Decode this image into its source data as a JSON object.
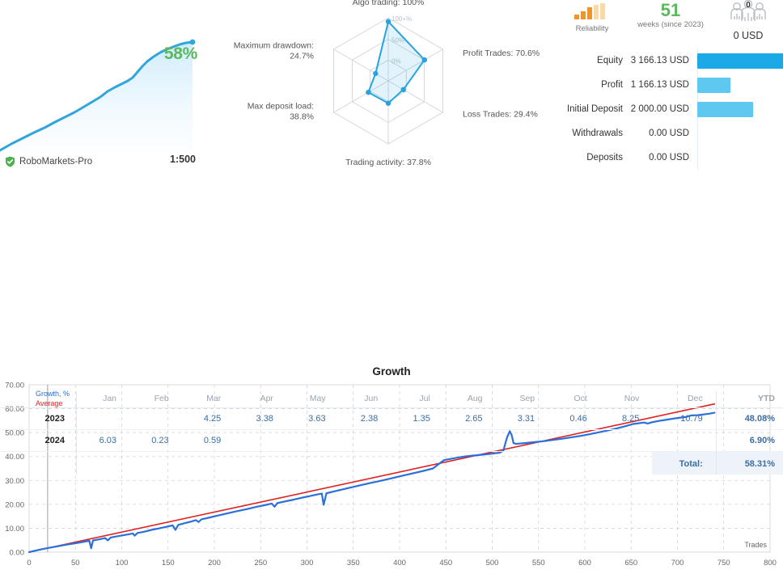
{
  "sparkline": {
    "percent_label": "58%",
    "percent_color": "#5cb85c",
    "broker": "RoboMarkets-Pro",
    "leverage": "1:500",
    "verified_icon": "shield-check-icon",
    "line_color": "#32a5dc",
    "points": [
      [
        0,
        178
      ],
      [
        14,
        170
      ],
      [
        28,
        163
      ],
      [
        42,
        156
      ],
      [
        55,
        150
      ],
      [
        68,
        143
      ],
      [
        80,
        137
      ],
      [
        92,
        131
      ],
      [
        104,
        124
      ],
      [
        114,
        118
      ],
      [
        124,
        112
      ],
      [
        133,
        105
      ],
      [
        142,
        100
      ],
      [
        150,
        96
      ],
      [
        158,
        92
      ],
      [
        164,
        88
      ],
      [
        170,
        81
      ],
      [
        176,
        74
      ],
      [
        182,
        68
      ],
      [
        190,
        62
      ],
      [
        198,
        57
      ],
      [
        206,
        53
      ],
      [
        214,
        50
      ],
      [
        222,
        47
      ],
      [
        230,
        45
      ],
      [
        238,
        44
      ]
    ]
  },
  "radar": {
    "center": [
      218,
      100
    ],
    "max_radius": 78,
    "rings": [
      "100+%",
      "50%",
      "0%"
    ],
    "axes": [
      {
        "name": "Algo trading",
        "label": "Algo trading: 100%",
        "value": 100
      },
      {
        "name": "Profit Trades",
        "label": "Profit Trades: 70.6%",
        "value": 70.6
      },
      {
        "name": "Loss Trades",
        "label": "Loss Trades: 29.4%",
        "value": 29.4
      },
      {
        "name": "Trading activity",
        "label": "Trading activity: 37.8%",
        "value": 37.8
      },
      {
        "name": "Max deposit load",
        "label": "Max deposit load:",
        "label2": "38.8%",
        "value": 38.8
      },
      {
        "name": "Maximum drawdown",
        "label": "Maximum drawdown:",
        "label2": "24.7%",
        "value": 24.7
      }
    ],
    "fill_color": "#2aa3dd",
    "grid_color": "#cfd6dc"
  },
  "stats": {
    "reliability_caption": "Reliability",
    "reliability_icon": "signal-bars-icon",
    "reliability_level": 3,
    "weeks_value": "51",
    "weeks_caption": "weeks (since 2023)",
    "subscribers_icon": "people-icon",
    "subscribers_count": "0",
    "subscribers_amount": "0 USD",
    "rows": [
      {
        "label": "Equity",
        "value": "3 166.13 USD",
        "bar_pct": 100,
        "color": "#1ca9e8"
      },
      {
        "label": "Profit",
        "value": "1 166.13 USD",
        "bar_pct": 37,
        "color": "#5fc8f0"
      },
      {
        "label": "Initial Deposit",
        "value": "2 000.00 USD",
        "bar_pct": 63,
        "color": "#5fc8f0"
      },
      {
        "label": "Withdrawals",
        "value": "0.00 USD",
        "bar_pct": 0,
        "color": "#5fc8f0"
      },
      {
        "label": "Deposits",
        "value": "0.00 USD",
        "bar_pct": 0,
        "color": "#5fc8f0"
      }
    ]
  },
  "chart_data": {
    "type": "line",
    "title": "Growth",
    "xlabel": "Trades",
    "ylabel": "",
    "xlim": [
      0,
      800
    ],
    "ylim": [
      0,
      70
    ],
    "xticks": [
      0,
      50,
      100,
      150,
      200,
      250,
      300,
      350,
      400,
      450,
      500,
      550,
      600,
      650,
      700,
      750,
      800
    ],
    "yticks": [
      "0.00",
      "10.00",
      "20.00",
      "30.00",
      "40.00",
      "50.00",
      "60.00",
      "70.00"
    ],
    "grid": true,
    "legend": [
      {
        "name": "Growth, %",
        "color": "#2a6fdb"
      },
      {
        "name": "Average",
        "color": "#e02020"
      }
    ],
    "series": [
      {
        "name": "Growth, %",
        "color": "#2a6fdb",
        "points": [
          [
            0,
            0.0
          ],
          [
            10,
            0.9
          ],
          [
            20,
            1.7
          ],
          [
            30,
            2.4
          ],
          [
            40,
            3.1
          ],
          [
            50,
            3.7
          ],
          [
            60,
            4.4
          ],
          [
            65,
            4.8
          ],
          [
            67,
            1.6
          ],
          [
            69,
            4.9
          ],
          [
            75,
            5.3
          ],
          [
            82,
            5.9
          ],
          [
            85,
            4.9
          ],
          [
            88,
            6.1
          ],
          [
            95,
            6.6
          ],
          [
            105,
            7.3
          ],
          [
            112,
            7.8
          ],
          [
            114,
            6.9
          ],
          [
            117,
            8.0
          ],
          [
            125,
            8.6
          ],
          [
            132,
            9.3
          ],
          [
            140,
            9.9
          ],
          [
            148,
            10.6
          ],
          [
            155,
            11.2
          ],
          [
            158,
            9.3
          ],
          [
            161,
            11.4
          ],
          [
            168,
            12.1
          ],
          [
            175,
            12.8
          ],
          [
            180,
            13.4
          ],
          [
            183,
            12.6
          ],
          [
            186,
            13.7
          ],
          [
            195,
            14.5
          ],
          [
            205,
            15.4
          ],
          [
            215,
            16.3
          ],
          [
            225,
            17.2
          ],
          [
            235,
            18.0
          ],
          [
            245,
            18.9
          ],
          [
            255,
            19.7
          ],
          [
            262,
            20.3
          ],
          [
            265,
            19.0
          ],
          [
            268,
            20.5
          ],
          [
            275,
            21.1
          ],
          [
            285,
            21.9
          ],
          [
            295,
            22.8
          ],
          [
            305,
            23.6
          ],
          [
            312,
            24.2
          ],
          [
            316,
            24.5
          ],
          [
            318,
            19.8
          ],
          [
            321,
            24.6
          ],
          [
            328,
            25.3
          ],
          [
            338,
            26.2
          ],
          [
            348,
            27.1
          ],
          [
            358,
            28.0
          ],
          [
            368,
            28.9
          ],
          [
            378,
            29.7
          ],
          [
            388,
            30.6
          ],
          [
            398,
            31.5
          ],
          [
            408,
            32.4
          ],
          [
            418,
            33.3
          ],
          [
            428,
            34.2
          ],
          [
            436,
            35.0
          ],
          [
            440,
            36.2
          ],
          [
            448,
            38.5
          ],
          [
            455,
            39.0
          ],
          [
            462,
            39.5
          ],
          [
            470,
            40.0
          ],
          [
            480,
            40.4
          ],
          [
            490,
            40.8
          ],
          [
            500,
            41.2
          ],
          [
            508,
            41.6
          ],
          [
            512,
            42.4
          ],
          [
            516,
            48.0
          ],
          [
            519,
            50.6
          ],
          [
            521,
            49.0
          ],
          [
            523,
            45.6
          ],
          [
            526,
            45.3
          ],
          [
            535,
            45.6
          ],
          [
            545,
            46.0
          ],
          [
            555,
            46.4
          ],
          [
            565,
            46.9
          ],
          [
            575,
            47.4
          ],
          [
            585,
            48.0
          ],
          [
            595,
            48.6
          ],
          [
            605,
            49.3
          ],
          [
            615,
            50.1
          ],
          [
            625,
            50.9
          ],
          [
            635,
            51.8
          ],
          [
            645,
            52.8
          ],
          [
            652,
            53.6
          ],
          [
            658,
            53.9
          ],
          [
            664,
            54.2
          ],
          [
            668,
            53.8
          ],
          [
            672,
            54.3
          ],
          [
            680,
            54.9
          ],
          [
            690,
            55.5
          ],
          [
            700,
            56.1
          ],
          [
            710,
            56.6
          ],
          [
            715,
            57.2
          ],
          [
            722,
            57.3
          ],
          [
            728,
            57.6
          ],
          [
            734,
            57.9
          ],
          [
            740,
            58.3
          ]
        ]
      },
      {
        "name": "Average",
        "color": "#e02020",
        "points": [
          [
            0,
            0.0
          ],
          [
            740,
            62.0
          ]
        ]
      }
    ]
  },
  "months_table": {
    "headers": [
      "",
      "Jan",
      "Feb",
      "Mar",
      "Apr",
      "May",
      "Jun",
      "Jul",
      "Aug",
      "Sep",
      "Oct",
      "Nov",
      "Dec",
      "YTD"
    ],
    "rows": [
      {
        "year": "2023",
        "months": [
          "",
          "",
          "4.25",
          "3.38",
          "3.63",
          "2.38",
          "1.35",
          "2.65",
          "3.31",
          "0.46",
          "8.25",
          "10.79"
        ],
        "ytd": "48.08%"
      },
      {
        "year": "2024",
        "months": [
          "6.03",
          "0.23",
          "0.59",
          "",
          "",
          "",
          "",
          "",
          "",
          "",
          "",
          ""
        ],
        "ytd": "6.90%"
      }
    ],
    "total_label": "Total:",
    "total_value": "58.31%"
  }
}
